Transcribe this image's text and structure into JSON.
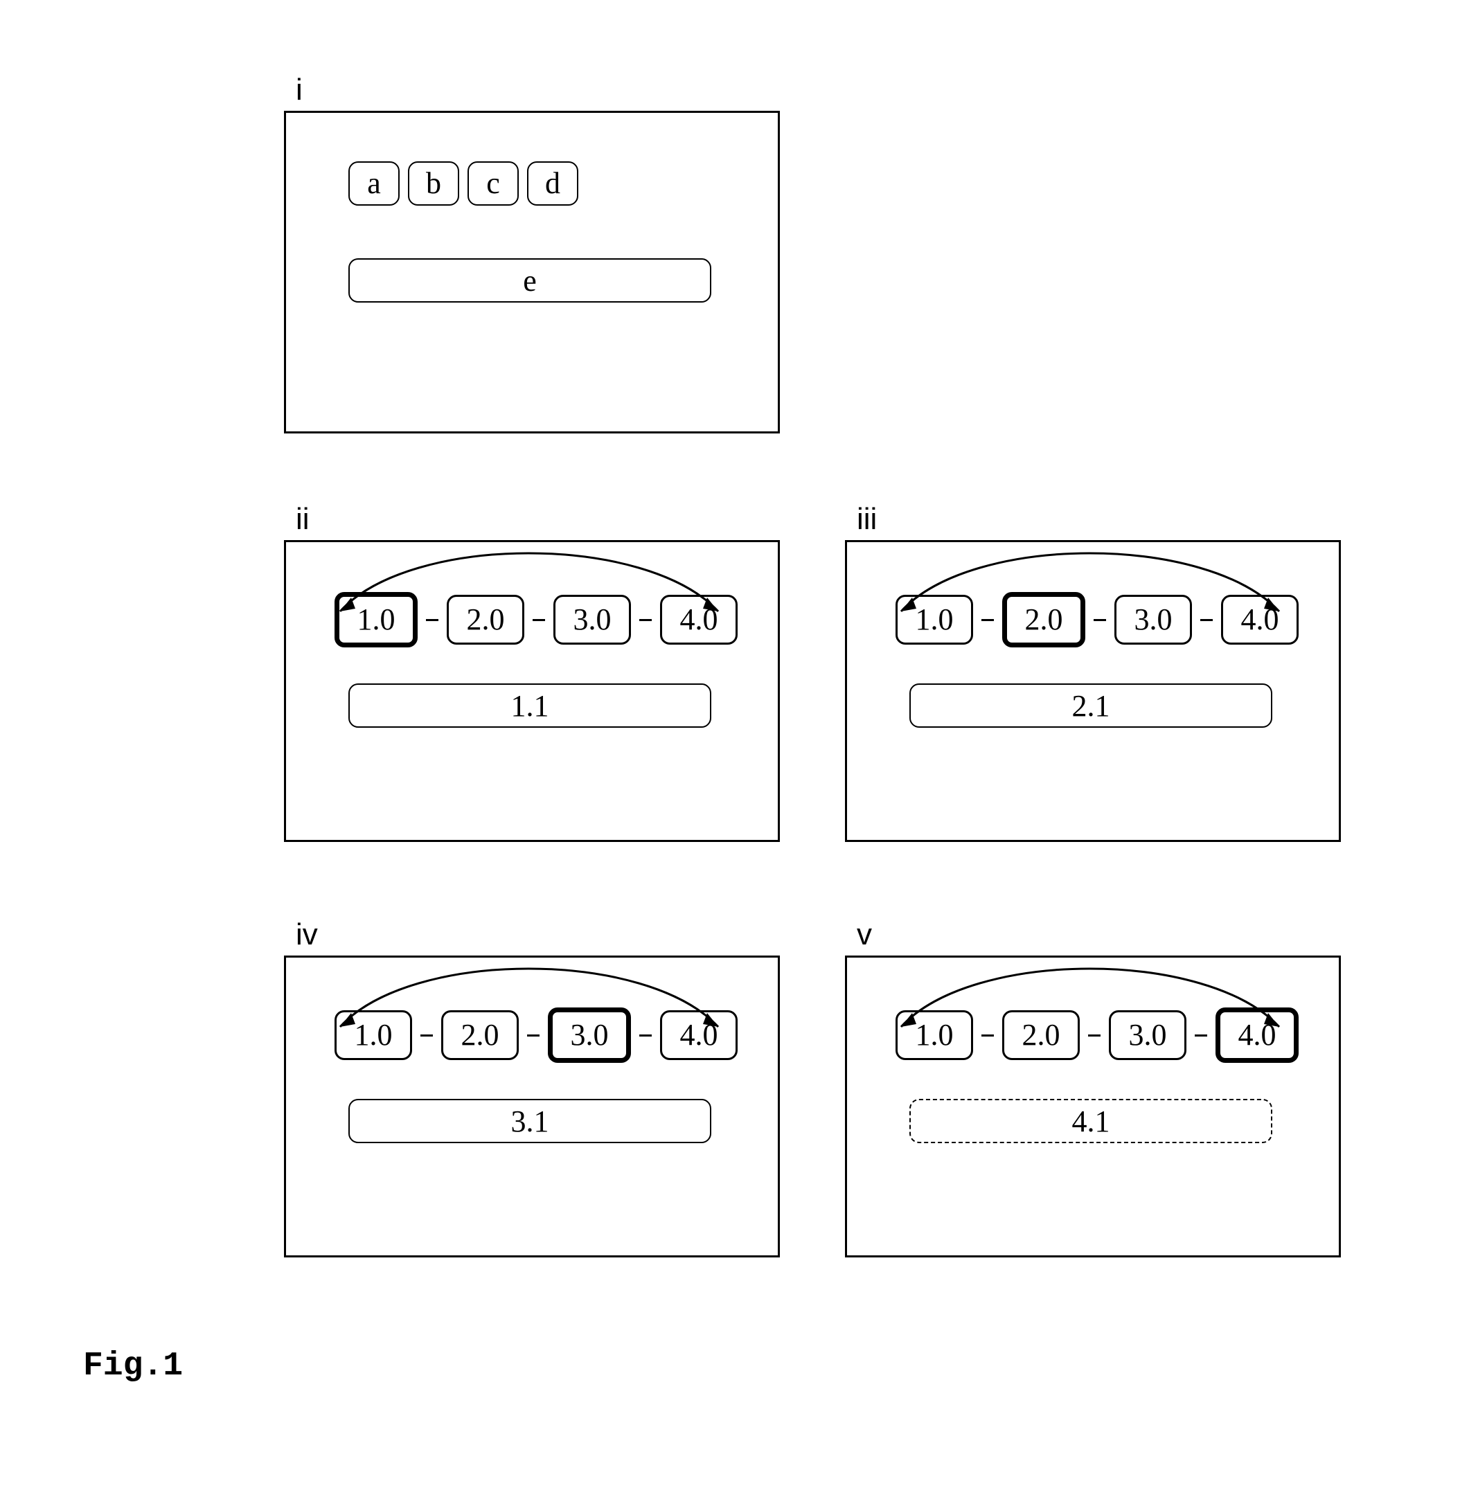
{
  "figure_label": "Fig.1",
  "panels": {
    "i": {
      "tag": "i",
      "buttons": [
        "a",
        "b",
        "c",
        "d"
      ],
      "wide": "e"
    },
    "ii": {
      "tag": "ii",
      "pills": [
        "1.0",
        "2.0",
        "3.0",
        "4.0"
      ],
      "selected_index": 0,
      "wide": "1.1",
      "wide_dashed": false
    },
    "iii": {
      "tag": "iii",
      "pills": [
        "1.0",
        "2.0",
        "3.0",
        "4.0"
      ],
      "selected_index": 1,
      "wide": "2.1",
      "wide_dashed": false
    },
    "iv": {
      "tag": "iv",
      "pills": [
        "1.0",
        "2.0",
        "3.0",
        "4.0"
      ],
      "selected_index": 2,
      "wide": "3.1",
      "wide_dashed": false
    },
    "v": {
      "tag": "v",
      "pills": [
        "1.0",
        "2.0",
        "3.0",
        "4.0"
      ],
      "selected_index": 3,
      "wide": "4.1",
      "wide_dashed": true
    }
  }
}
